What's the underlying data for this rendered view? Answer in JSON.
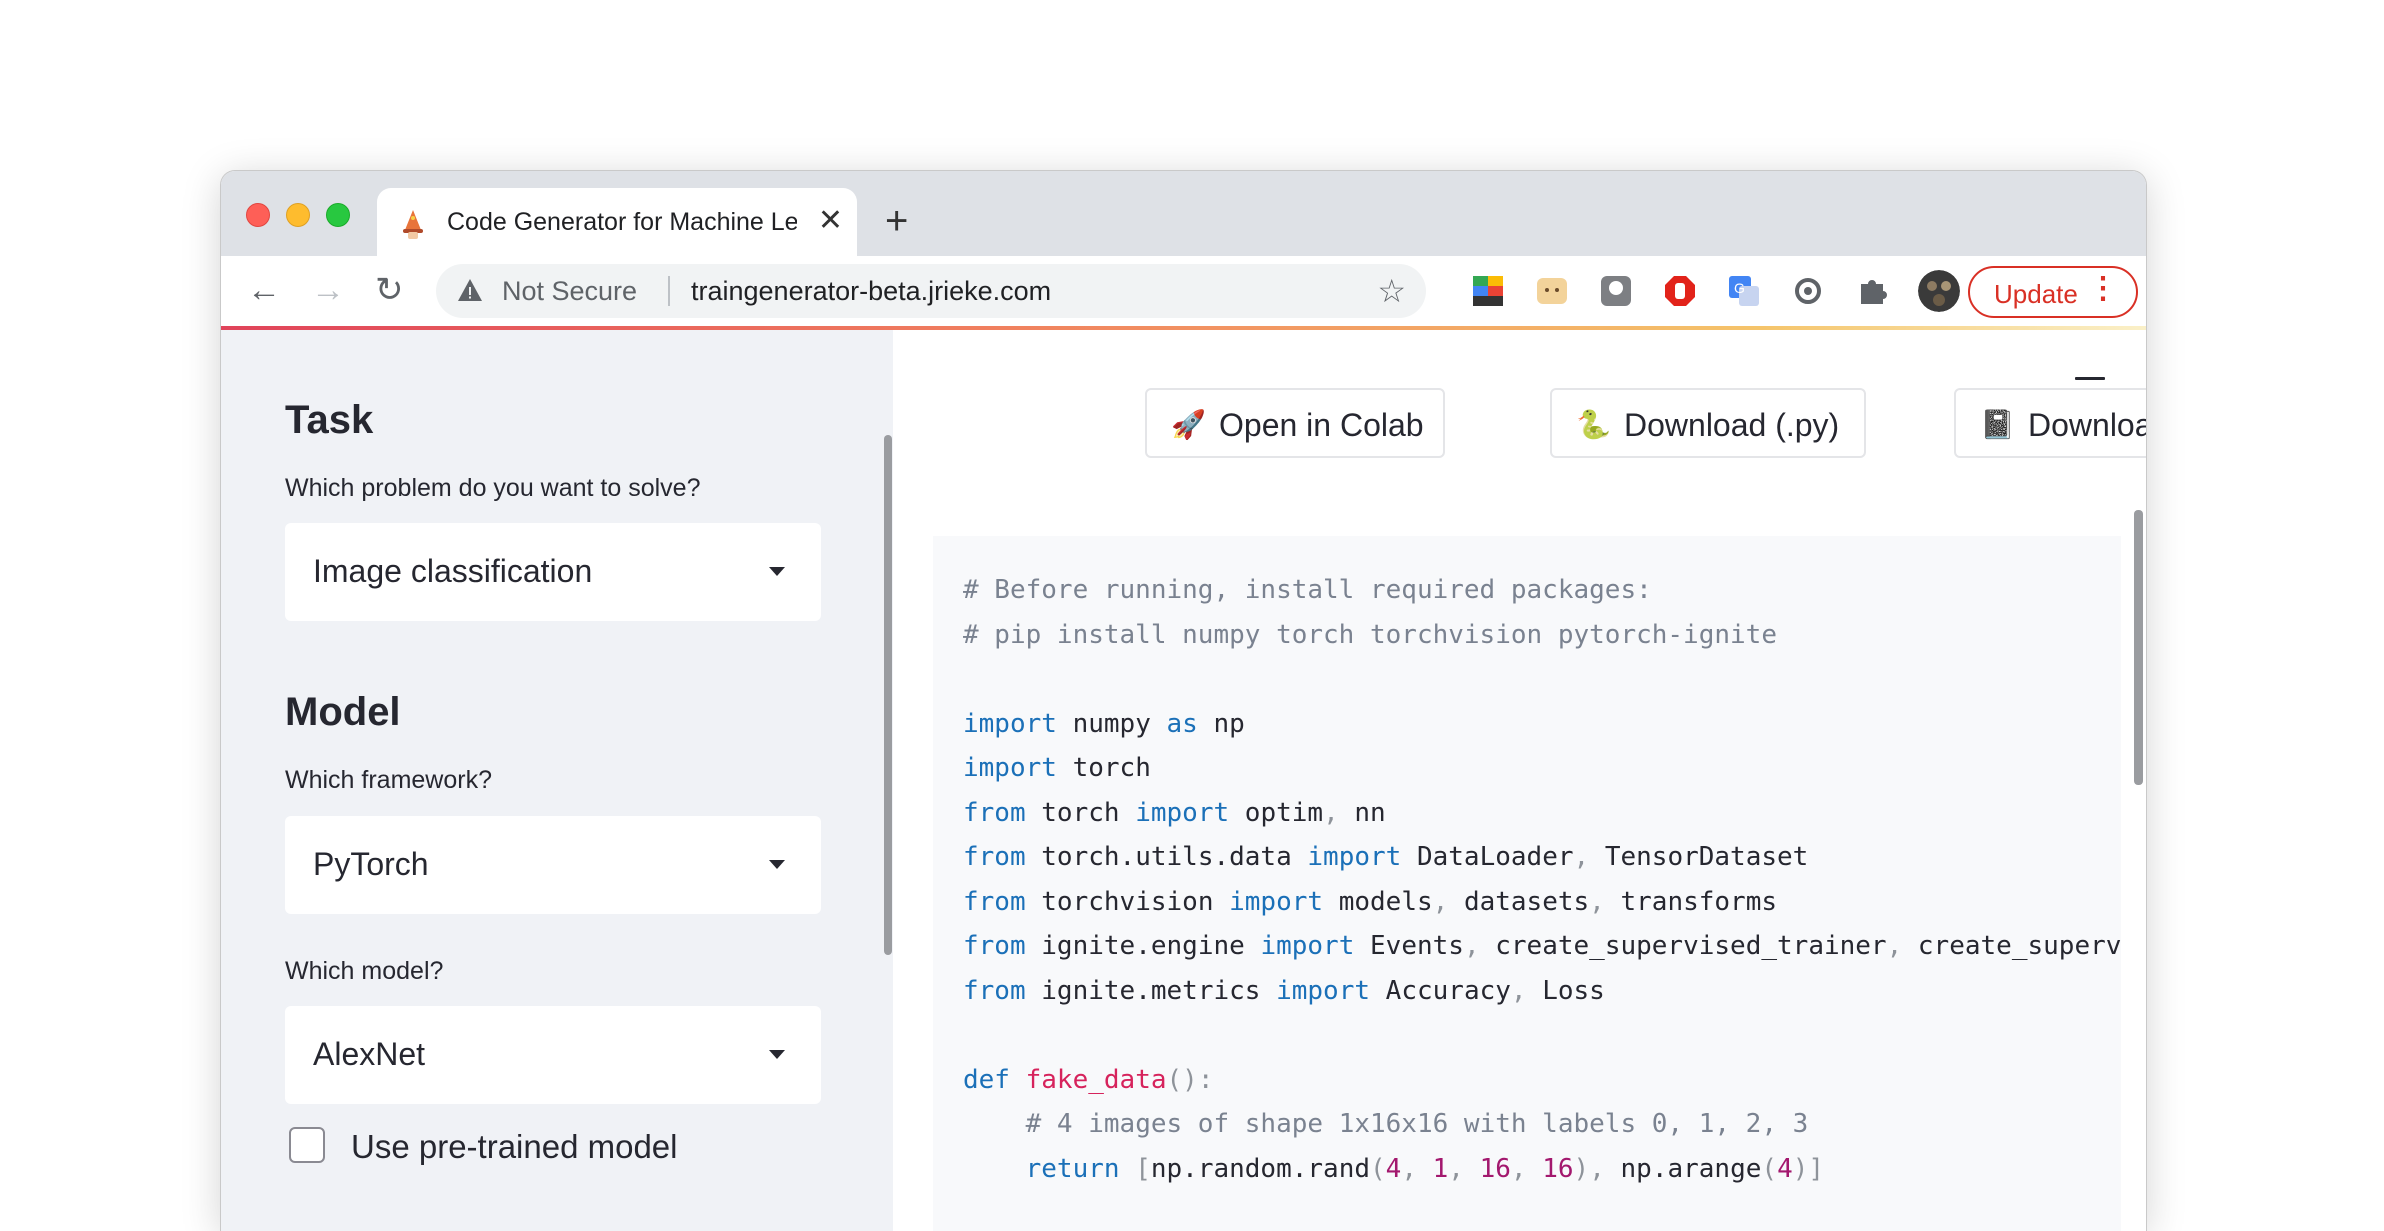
{
  "browser": {
    "tab_title": "Code Generator for Machine Le",
    "tab_close": "✕",
    "new_tab": "+",
    "back": "←",
    "forward": "→",
    "reload": "↻",
    "security_label": "Not Secure",
    "url": "traingenerator-beta.jrieke.com",
    "star": "☆",
    "update_label": "Update",
    "menu_dots": "⋮"
  },
  "sidebar": {
    "task_heading": "Task",
    "task_question": "Which problem do you want to solve?",
    "task_value": "Image classification",
    "model_heading": "Model",
    "framework_question": "Which framework?",
    "framework_value": "PyTorch",
    "model_question": "Which model?",
    "model_value": "AlexNet",
    "pretrained_label": "Use pre-trained model"
  },
  "main": {
    "colab_label": "Open in Colab",
    "colab_icon": "🚀",
    "download_py_label": "Download (.py)",
    "download_py_icon": "🐍",
    "download_ipynb_label": "Download (.ipynb)",
    "download_ipynb_icon": "📓"
  },
  "code": {
    "c1": "# Before running, install required packages:",
    "c2": "# pip install numpy torch torchvision pytorch-ignite",
    "import": "import",
    "from": "from",
    "as": "as",
    "def": "def",
    "return": "return",
    "numpy": "numpy",
    "np": "np",
    "torch": "torch",
    "optim": "optim",
    "nn": "nn",
    "torch_utils_data": "torch.utils.data",
    "dataloader": "DataLoader",
    "tensordataset": "TensorDataset",
    "torchvision": "torchvision",
    "models": "models",
    "datasets": "datasets",
    "transforms": "transforms",
    "ignite_engine": "ignite.engine",
    "events": "Events",
    "create_trainer": "create_supervised_trainer",
    "create_superv": "create_supervi",
    "ignite_metrics": "ignite.metrics",
    "accuracy": "Accuracy",
    "loss": "Loss",
    "fake_data": "fake_data",
    "def_parens": "():",
    "c3": "# 4 images of shape 1x16x16 with labels 0, 1, 2, 3",
    "np_random_rand": "np.random.rand",
    "n4": "4",
    "n1": "1",
    "n16": "16",
    "np_arange": "np.arange"
  },
  "colors": {
    "keyword": "#1b70b8",
    "comment": "#7a8290",
    "function": "#d6235c",
    "number": "#a3186e",
    "update_red": "#d93025"
  }
}
